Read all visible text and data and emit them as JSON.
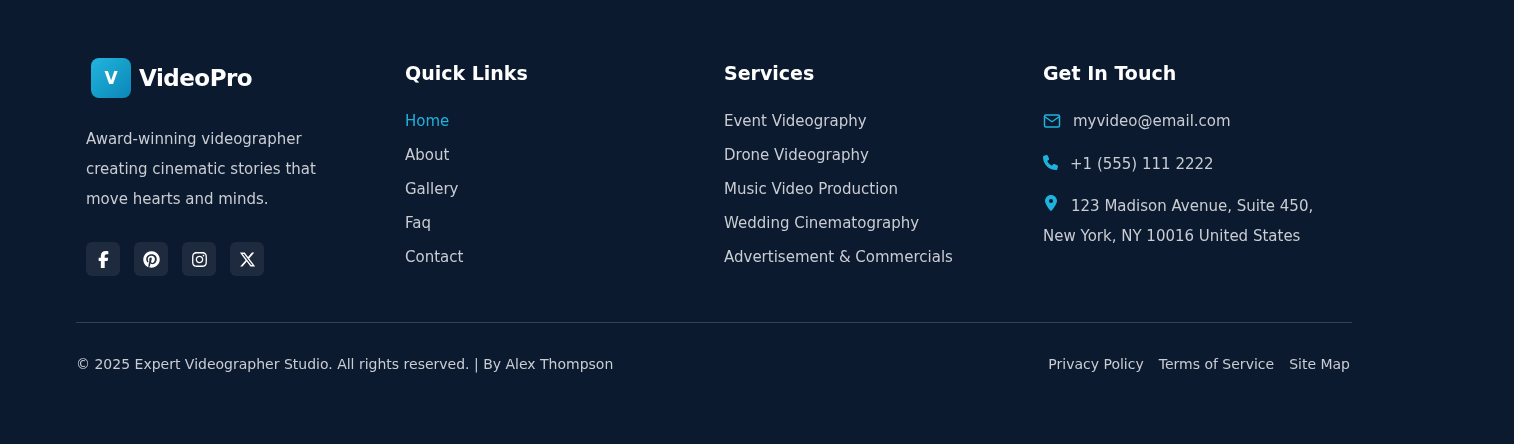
{
  "brand": {
    "logo_letter": "V",
    "name": "VideoPro",
    "tagline": "Award-winning videographer creating cinematic stories that move hearts and minds."
  },
  "socials": [
    {
      "kind": "facebook"
    },
    {
      "kind": "pinterest"
    },
    {
      "kind": "instagram"
    },
    {
      "kind": "x"
    }
  ],
  "quick_links": {
    "title": "Quick Links",
    "items": [
      {
        "label": "Home",
        "selected": true
      },
      {
        "label": "About",
        "selected": false
      },
      {
        "label": "Gallery",
        "selected": false
      },
      {
        "label": "Faq",
        "selected": false
      },
      {
        "label": "Contact",
        "selected": false
      }
    ]
  },
  "services": {
    "title": "Services",
    "items": [
      "Event Videography",
      "Drone Videography",
      "Music Video Production",
      "Wedding Cinematography",
      "Advertisement & Commercials"
    ]
  },
  "contact": {
    "title": "Get In Touch",
    "items": [
      {
        "kind": "email",
        "text": "myvideo@email.com"
      },
      {
        "kind": "phone",
        "text": "+1 (555) 111 2222"
      },
      {
        "kind": "location",
        "text": "123 Madison Avenue, Suite 450, New York, NY 10016 United States"
      }
    ]
  },
  "copyright": "© 2025 Expert Videographer Studio. All rights reserved. | By Alex Thompson",
  "legal_links": [
    "Privacy Policy",
    "Terms of Service",
    "Site Map"
  ]
}
